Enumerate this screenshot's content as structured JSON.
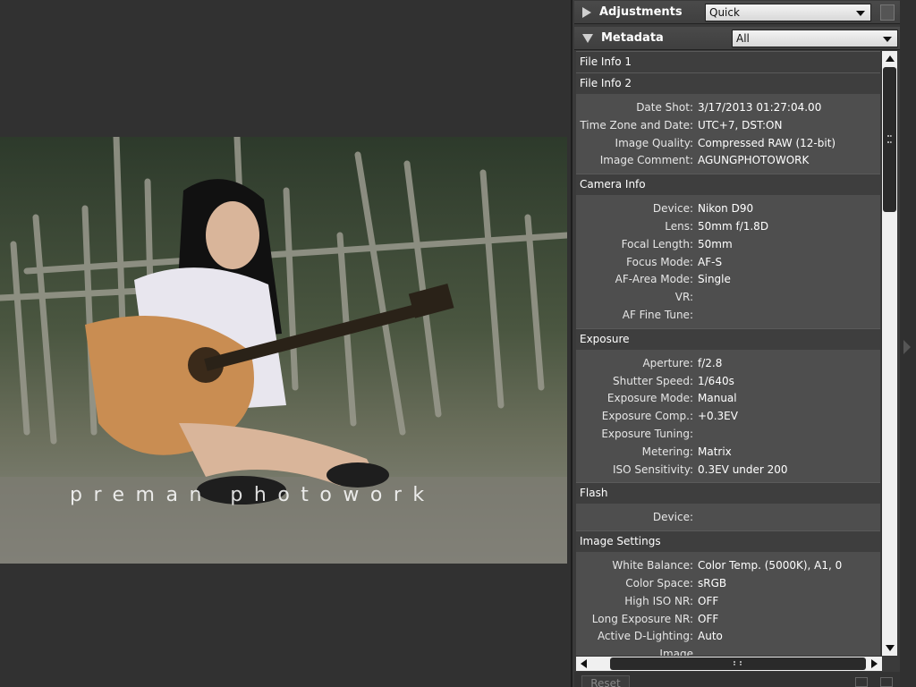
{
  "image": {
    "watermark": "preman photowork"
  },
  "adjustments": {
    "title": "Adjustments",
    "selected": "Quick"
  },
  "metadata": {
    "title": "Metadata",
    "selected": "All",
    "file_info_1": "File Info 1",
    "file_info_2": {
      "label": "File Info 2",
      "rows": [
        {
          "label": "Date Shot:",
          "value": "3/17/2013 01:27:04.00"
        },
        {
          "label": "Time Zone and Date:",
          "value": "UTC+7, DST:ON"
        },
        {
          "label": "Image Quality:",
          "value": "Compressed RAW (12-bit)"
        },
        {
          "label": "Image Comment:",
          "value": "AGUNGPHOTOWORK"
        }
      ]
    },
    "camera_info": {
      "label": "Camera Info",
      "rows": [
        {
          "label": "Device:",
          "value": "Nikon D90"
        },
        {
          "label": "Lens:",
          "value": "50mm f/1.8D"
        },
        {
          "label": "Focal Length:",
          "value": "50mm"
        },
        {
          "label": "Focus Mode:",
          "value": "AF-S"
        },
        {
          "label": "AF-Area Mode:",
          "value": "Single"
        },
        {
          "label": "VR:",
          "value": ""
        },
        {
          "label": "AF Fine Tune:",
          "value": ""
        }
      ]
    },
    "exposure": {
      "label": "Exposure",
      "rows": [
        {
          "label": "Aperture:",
          "value": "f/2.8"
        },
        {
          "label": "Shutter Speed:",
          "value": "1/640s"
        },
        {
          "label": "Exposure Mode:",
          "value": "Manual"
        },
        {
          "label": "Exposure Comp.:",
          "value": "+0.3EV"
        },
        {
          "label": "Exposure Tuning:",
          "value": ""
        },
        {
          "label": "Metering:",
          "value": "Matrix"
        },
        {
          "label": "ISO Sensitivity:",
          "value": "0.3EV under 200"
        }
      ]
    },
    "flash": {
      "label": "Flash",
      "rows": [
        {
          "label": "Device:",
          "value": ""
        }
      ]
    },
    "image_settings": {
      "label": "Image Settings",
      "rows": [
        {
          "label": "White Balance:",
          "value": "Color Temp. (5000K), A1, 0"
        },
        {
          "label": "Color Space:",
          "value": "sRGB"
        },
        {
          "label": "High ISO NR:",
          "value": "OFF"
        },
        {
          "label": "Long Exposure NR:",
          "value": "OFF"
        },
        {
          "label": "Active D-Lighting:",
          "value": "Auto"
        },
        {
          "label": "Image Authentication:",
          "value": ""
        }
      ]
    }
  },
  "footer": {
    "reset_label": "Reset"
  }
}
